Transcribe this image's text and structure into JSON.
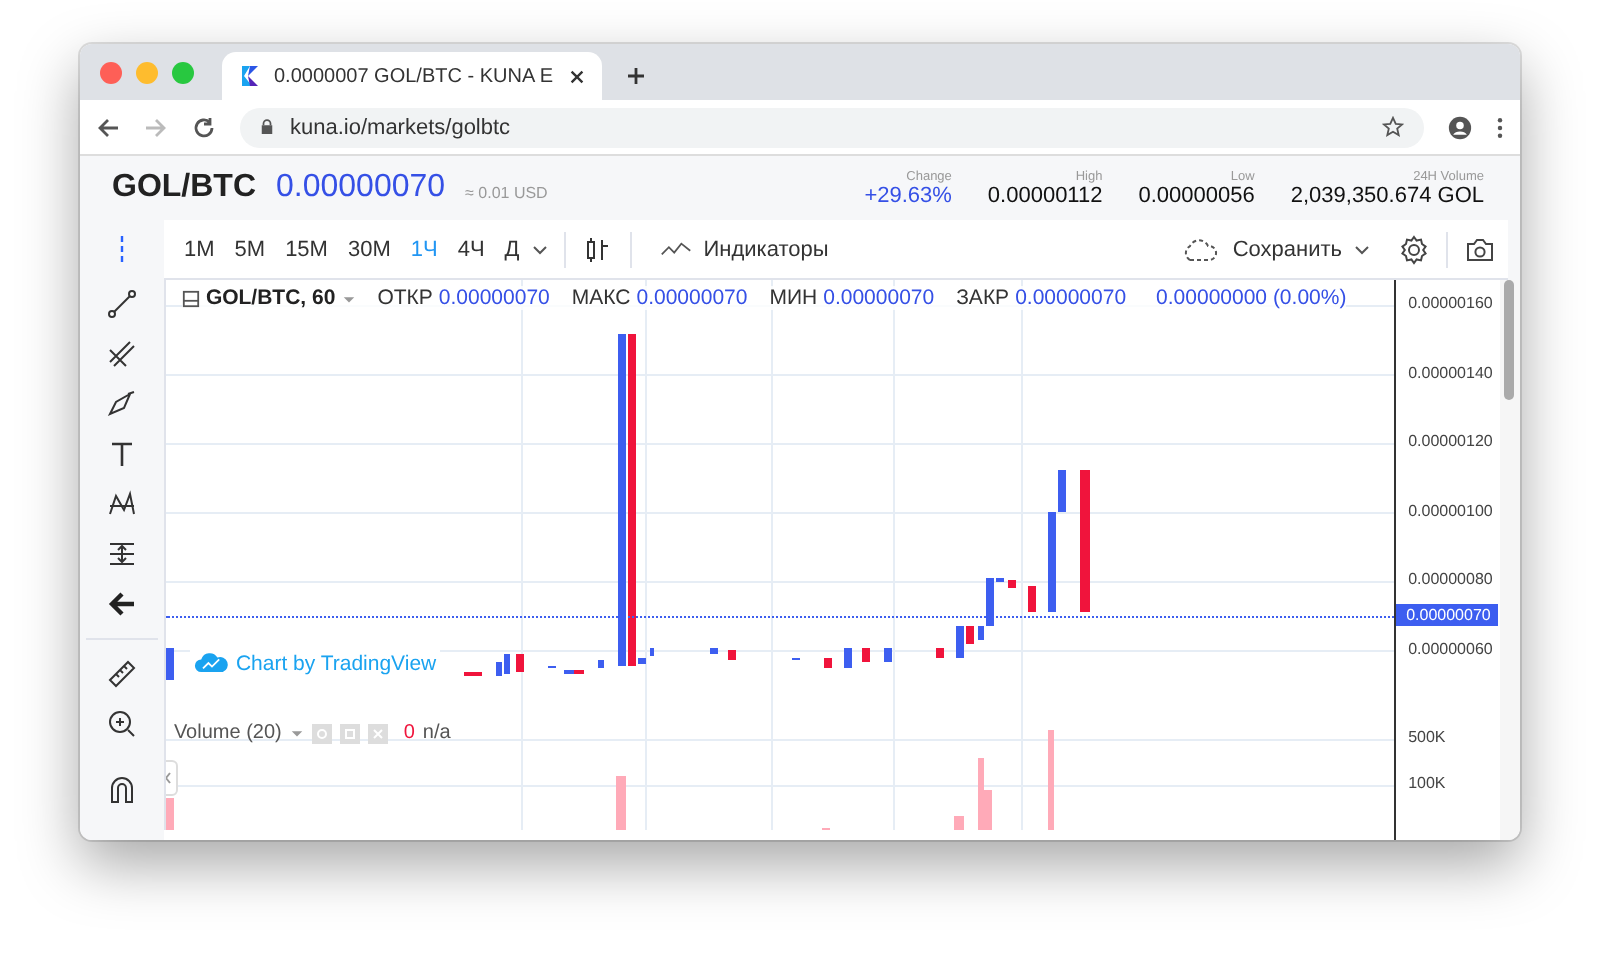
{
  "window": {
    "tab_title": "0.0000007 GOL/BTC - KUNA E",
    "url": "kuna.io/markets/golbtc"
  },
  "market": {
    "pair": "GOL/BTC",
    "price": "0.00000070",
    "price_usd": "≈ 0.01 USD",
    "stats": [
      {
        "label": "Change",
        "value": "+29.63%",
        "kind": "change"
      },
      {
        "label": "High",
        "value": "0.00000112",
        "kind": "plain"
      },
      {
        "label": "Low",
        "value": "0.00000056",
        "kind": "plain"
      },
      {
        "label": "24H Volume",
        "value": "2,039,350.674 GOL",
        "kind": "plain"
      }
    ]
  },
  "toolbar": {
    "intervals": [
      {
        "label": "1M",
        "selected": false
      },
      {
        "label": "5M",
        "selected": false
      },
      {
        "label": "15M",
        "selected": false
      },
      {
        "label": "30M",
        "selected": false
      },
      {
        "label": "1Ч",
        "selected": true
      },
      {
        "label": "4Ч",
        "selected": false
      },
      {
        "label": "Д",
        "selected": false
      }
    ],
    "indicators": "Индикаторы",
    "save": "Сохранить"
  },
  "legend": {
    "symbol": "GOL/BTC, 60",
    "fields": [
      {
        "label": "ОТКР",
        "value": "0.00000070"
      },
      {
        "label": "МАКС",
        "value": "0.00000070"
      },
      {
        "label": "МИН",
        "value": "0.00000070"
      },
      {
        "label": "ЗАКР",
        "value": "0.00000070"
      }
    ],
    "change": "0.00000000 (0.00%)"
  },
  "price_axis": [
    "0.00000160",
    "0.00000140",
    "0.00000120",
    "0.00000100",
    "0.00000080",
    "0.00000060"
  ],
  "current_price": "0.00000070",
  "attribution": "Chart by TradingView",
  "volume": {
    "label": "Volume (20)",
    "value": "0",
    "na": "n/a",
    "axis": [
      "500K",
      "100K"
    ]
  }
}
